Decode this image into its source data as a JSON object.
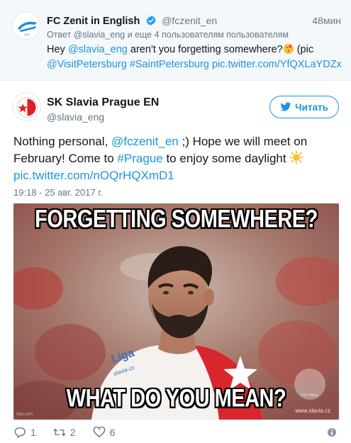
{
  "parent_tweet": {
    "author_name": "FC Zenit in English",
    "author_handle": "@fczenit_en",
    "time": "48мин",
    "reply_context": "Ответ @slavia_eng и еще 4 пользователям пользователям",
    "text": {
      "prefix": "Hey ",
      "mention": "@slavia_eng",
      "middle": " aren't you forgetting somewhere?",
      "after_emoji": " (pic",
      "mention2": "@VisitPetersburg",
      "hashtag": "#SaintPetersburg",
      "link": "pic.twitter.com/YfQXLaYDZx"
    }
  },
  "main_tweet": {
    "author_name": "SK Slavia Prague EN",
    "author_handle": "@slavia_eng",
    "follow_label": "Читать",
    "text": {
      "part1": "Nothing personal, ",
      "mention": "@fczenit_en",
      "part2": " ;) Hope we will meet on February! Come to ",
      "hashtag": "#Prague",
      "part3": " to enjoy some daylight ",
      "link": "pic.twitter.com/nOQrHQXmD1"
    },
    "timestamp": "19:18 - 25 авг. 2017 г.",
    "media": {
      "top_caption": "FORGETTING SOMEWHERE?",
      "bottom_caption": "WHAT DO YOU MEAN?",
      "watermark": "www.slavia.cz",
      "jersey_sponsor": "Liga",
      "jersey_url": "slavia.cz",
      "corner_mark": "r6lo.com",
      "crest_text": "FOTBAL"
    },
    "actions": {
      "replies": "1",
      "retweets": "2",
      "likes": "6"
    }
  },
  "colors": {
    "link": "#1b95e0",
    "muted": "#657786",
    "text": "#14171a",
    "parent_bg": "#f5f8fa",
    "slavia_red": "#e31e24"
  },
  "icons": {
    "verified": "verified-badge-icon",
    "twitter_bird": "twitter-bird-icon",
    "reply": "reply-icon",
    "retweet": "retweet-icon",
    "like": "heart-icon",
    "more": "more-vertical-icon",
    "sun_emoji": "sun-emoji-icon",
    "kiss_emoji": "kiss-emoji-icon"
  }
}
